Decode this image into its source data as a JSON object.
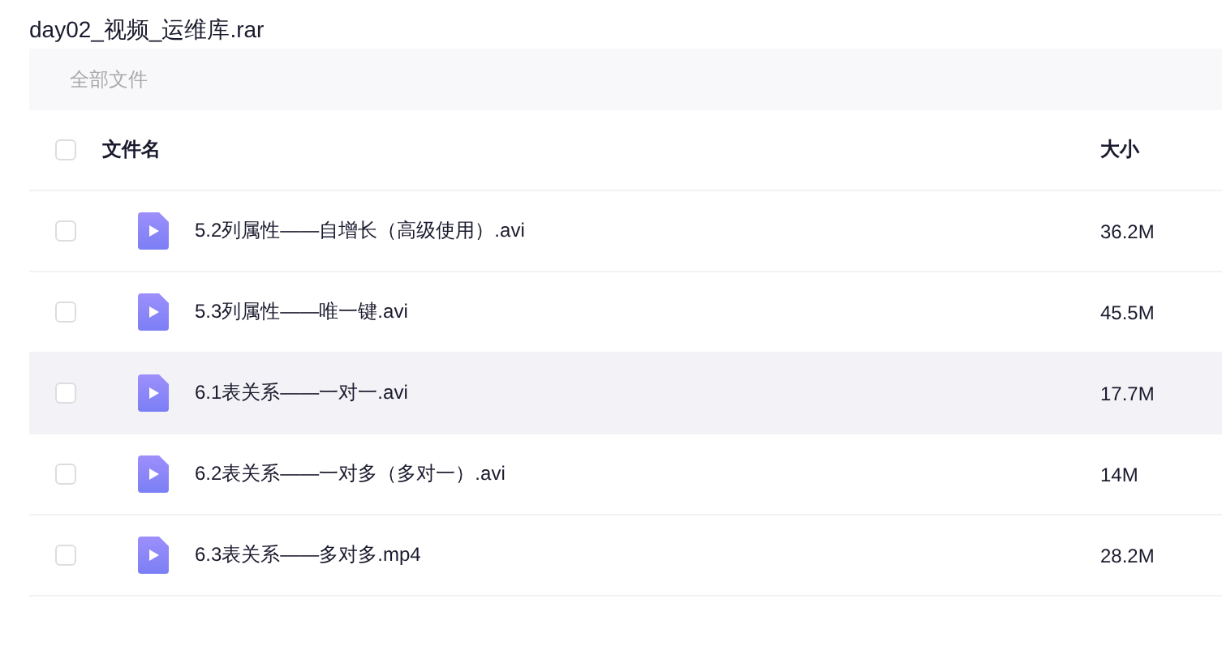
{
  "title": "day02_视频_运维库.rar",
  "breadcrumb": "全部文件",
  "table": {
    "columns": [
      "文件名",
      "大小"
    ],
    "header_checked": false,
    "rows": [
      {
        "name": "5.2列属性——自增长（高级使用）.avi",
        "size": "36.2M",
        "checked": false,
        "highlighted": false
      },
      {
        "name": "5.3列属性——唯一键.avi",
        "size": "45.5M",
        "checked": false,
        "highlighted": false
      },
      {
        "name": "6.1表关系——一对一.avi",
        "size": "17.7M",
        "checked": false,
        "highlighted": true
      },
      {
        "name": "6.2表关系——一对多（多对一）.avi",
        "size": "14M",
        "checked": false,
        "highlighted": false
      },
      {
        "name": "6.3表关系——多对多.mp4",
        "size": "28.2M",
        "checked": false,
        "highlighted": false
      }
    ]
  }
}
